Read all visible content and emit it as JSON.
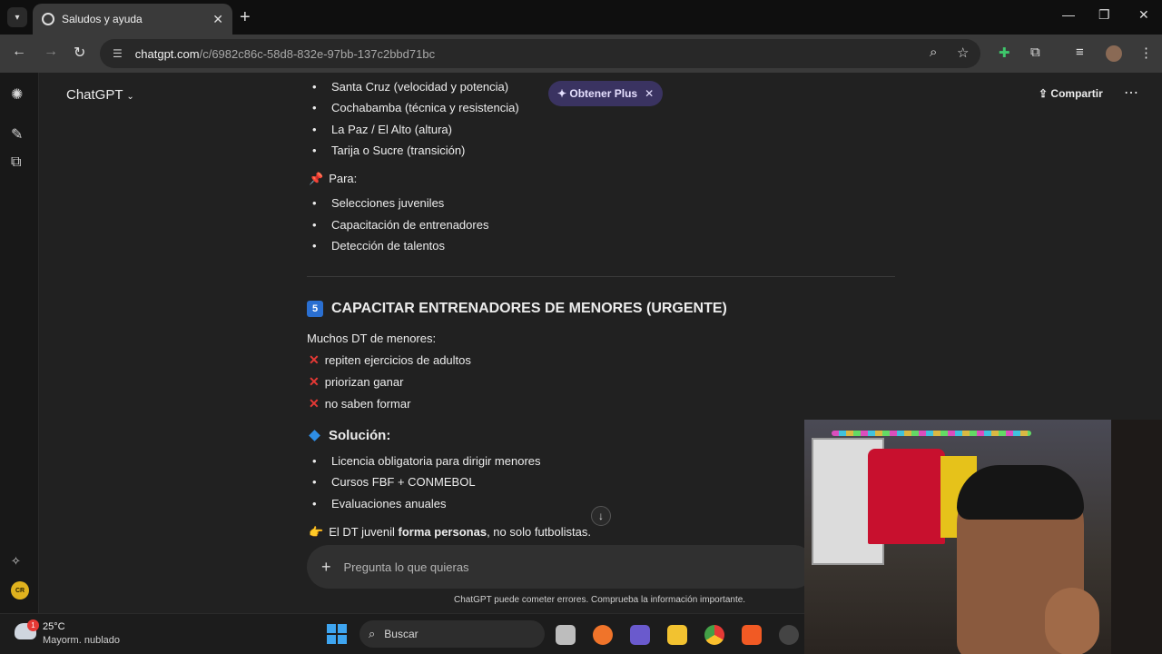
{
  "browser": {
    "tab_title": "Saludos y ayuda",
    "url_host": "chatgpt.com",
    "url_path": "/c/6982c86c-58d8-832e-97bb-137c2bbd71bc"
  },
  "header": {
    "model_title": "ChatGPT",
    "plus_label": "✦ Obtener Plus",
    "share_label": "Compartir"
  },
  "content": {
    "regions": [
      "Santa Cruz (velocidad y potencia)",
      "Cochabamba (técnica y resistencia)",
      "La Paz / El Alto (altura)",
      "Tarija o Sucre (transición)"
    ],
    "para_label": "Para:",
    "para_items": [
      "Selecciones juveniles",
      "Capacitación de entrenadores",
      "Detección de talentos"
    ],
    "section_number": "5",
    "section_title": "CAPACITAR ENTRENADORES DE MENORES (URGENTE)",
    "intro": "Muchos DT de menores:",
    "problems": [
      "repiten ejercicios de adultos",
      "priorizan ganar",
      "no saben formar"
    ],
    "solution_title": "Solución:",
    "solutions": [
      "Licencia obligatoria para dirigir menores",
      "Cursos FBF + CONMEBOL",
      "Evaluaciones anuales"
    ],
    "closing_prefix": "El DT juvenil ",
    "closing_bold": "forma personas",
    "closing_suffix": ", no solo futbolistas."
  },
  "composer": {
    "placeholder": "Pregunta lo que quieras",
    "disclaimer": "ChatGPT puede cometer errores. Comprueba la información importante."
  },
  "taskbar": {
    "temperature": "25°C",
    "weather": "Mayorm. nublado",
    "weather_badge": "1",
    "search_label": "Buscar"
  },
  "colors": {
    "background": "#212121",
    "accent_plus": "#3a3361",
    "error_red": "#e53935",
    "info_blue": "#2a6fd1"
  }
}
